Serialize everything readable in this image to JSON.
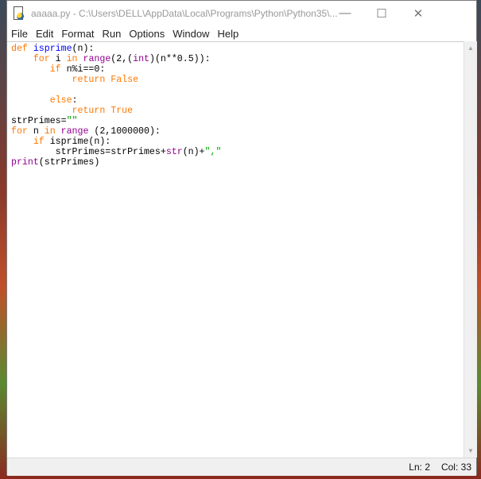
{
  "window": {
    "title": "aaaaa.py - C:\\Users\\DELL\\AppData\\Local\\Programs\\Python\\Python35\\...",
    "minimize": "—",
    "maximize": "☐",
    "close": "✕"
  },
  "menu": [
    "File",
    "Edit",
    "Format",
    "Run",
    "Options",
    "Window",
    "Help"
  ],
  "colors": {
    "keyword": "#ff7700",
    "builtin": "#900090",
    "definition": "#0000ff",
    "string": "#00aa00"
  },
  "code_lines": [
    [
      [
        "kw",
        "def"
      ],
      [
        "",
        " "
      ],
      [
        "df",
        "isprime"
      ],
      [
        "",
        "(n):"
      ]
    ],
    [
      [
        "",
        "    "
      ],
      [
        "kw",
        "for"
      ],
      [
        "",
        " i "
      ],
      [
        "kw",
        "in"
      ],
      [
        "",
        " "
      ],
      [
        "bi",
        "range"
      ],
      [
        "",
        "(2,("
      ],
      [
        "bi",
        "int"
      ],
      [
        "",
        ")(n**0.5)):"
      ]
    ],
    [
      [
        "",
        "       "
      ],
      [
        "kw",
        "if"
      ],
      [
        "",
        " n%i==0:"
      ]
    ],
    [
      [
        "",
        "           "
      ],
      [
        "kw",
        "return"
      ],
      [
        "",
        " "
      ],
      [
        "kw",
        "False"
      ]
    ],
    [
      [
        "",
        ""
      ]
    ],
    [
      [
        "",
        "       "
      ],
      [
        "kw",
        "else"
      ],
      [
        "",
        ":"
      ]
    ],
    [
      [
        "",
        "           "
      ],
      [
        "kw",
        "return"
      ],
      [
        "",
        " "
      ],
      [
        "kw",
        "True"
      ]
    ],
    [
      [
        "",
        "strPrimes="
      ],
      [
        "st",
        "\"\""
      ]
    ],
    [
      [
        "kw",
        "for"
      ],
      [
        "",
        " n "
      ],
      [
        "kw",
        "in"
      ],
      [
        "",
        " "
      ],
      [
        "bi",
        "range"
      ],
      [
        "",
        " (2,1000000):"
      ]
    ],
    [
      [
        "",
        "    "
      ],
      [
        "kw",
        "if"
      ],
      [
        "",
        " isprime(n):"
      ]
    ],
    [
      [
        "",
        "        strPrimes=strPrimes+"
      ],
      [
        "bi",
        "str"
      ],
      [
        "",
        "(n)+"
      ],
      [
        "st",
        "\",\""
      ]
    ],
    [
      [
        "bi",
        "print"
      ],
      [
        "",
        "(strPrimes)"
      ]
    ]
  ],
  "status": {
    "line": "Ln: 2",
    "column": "Col: 33"
  },
  "scrollbar": {
    "up": "▲",
    "down": "▼"
  }
}
